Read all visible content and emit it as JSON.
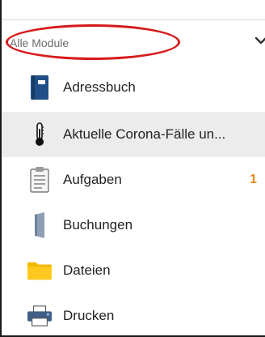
{
  "module_select": {
    "label": "Alle Module",
    "icon": "chevron-down-icon"
  },
  "items": [
    {
      "label": "Adressbuch",
      "icon": "address-book-icon"
    },
    {
      "label": "Aktuelle Corona-Fälle un...",
      "icon": "thermometer-icon"
    },
    {
      "label": "Aufgaben",
      "icon": "clipboard-icon",
      "badge": "1"
    },
    {
      "label": "Buchungen",
      "icon": "door-icon"
    },
    {
      "label": "Dateien",
      "icon": "folder-icon"
    },
    {
      "label": "Drucken",
      "icon": "printer-icon"
    }
  ],
  "colors": {
    "highlight": "#d61a1a",
    "badge": "#e8891a",
    "active_row": "#ececec",
    "address_book": "#1f4f86",
    "folder": "#f5b800",
    "door": "#8e9fb3",
    "printer": "#3f5f86"
  }
}
